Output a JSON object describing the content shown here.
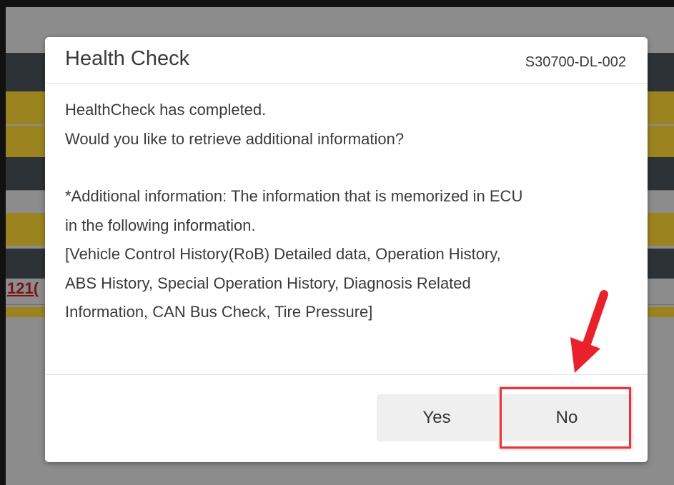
{
  "background": {
    "link_text": "121("
  },
  "dialog": {
    "title": "Health Check",
    "code": "S30700-DL-002",
    "body": {
      "line1": "HealthCheck has completed.",
      "line2": "Would you like to retrieve additional information?",
      "line3": "*Additional information: The information that is memorized in ECU",
      "line4": "in the following information.",
      "line5": "[Vehicle Control History(RoB) Detailed data, Operation History,",
      "line6": "ABS History, Special Operation History, Diagnosis Related",
      "line7": "Information, CAN Bus Check, Tire Pressure]"
    },
    "buttons": {
      "yes_label": "Yes",
      "no_label": "No"
    }
  },
  "annotation": {
    "highlight_color": "#e8343c",
    "arrow_color": "#e8212a",
    "target": "No"
  },
  "colors": {
    "band_dark": "#2c3236",
    "band_gold": "#9b8420",
    "overlay_gray": "#8c8c8c"
  }
}
